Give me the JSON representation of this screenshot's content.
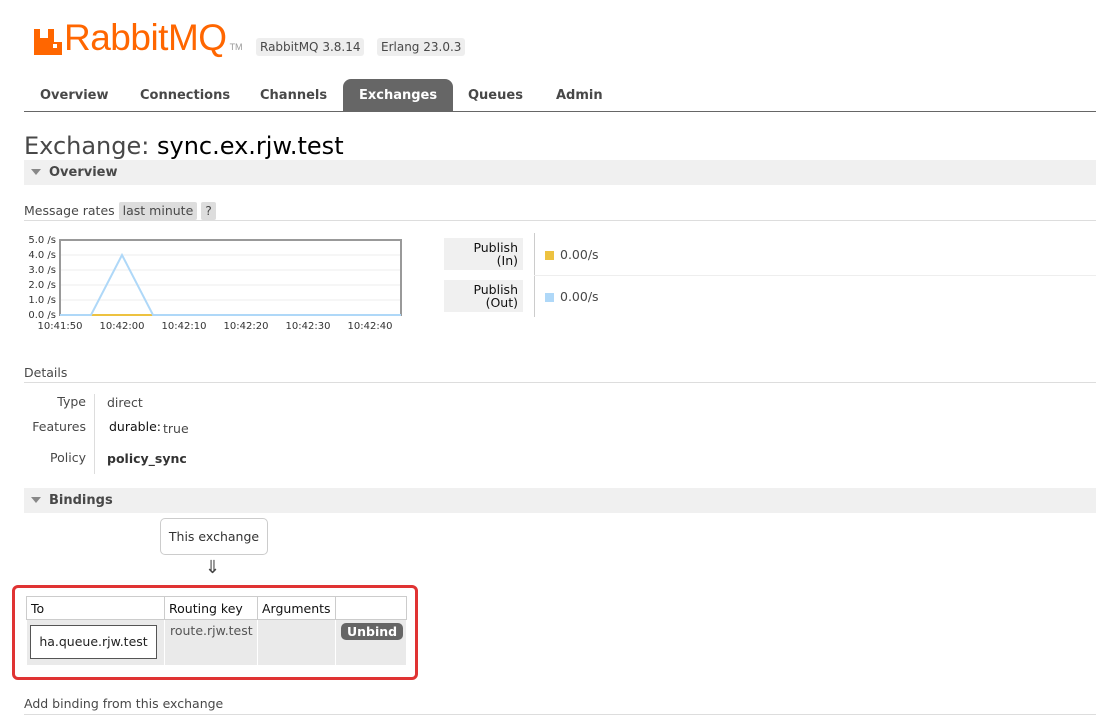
{
  "app": {
    "brand": "RabbitMQ",
    "trademark": "TM",
    "version": "RabbitMQ 3.8.14",
    "erlang": "Erlang 23.0.3",
    "brand_color": "#ff6600"
  },
  "tabs": [
    {
      "label": "Overview",
      "active": false
    },
    {
      "label": "Connections",
      "active": false
    },
    {
      "label": "Channels",
      "active": false
    },
    {
      "label": "Exchanges",
      "active": true
    },
    {
      "label": "Queues",
      "active": false
    },
    {
      "label": "Admin",
      "active": false
    }
  ],
  "page": {
    "title_prefix": "Exchange:",
    "exchange_name": "sync.ex.rjw.test"
  },
  "overview": {
    "section_label": "Overview",
    "rates_label": "Message rates",
    "period": "last minute",
    "help": "?",
    "publish_in": {
      "label_line1": "Publish",
      "label_line2": "(In)",
      "value": "0.00/s",
      "color": "#edc240"
    },
    "publish_out": {
      "label_line1": "Publish",
      "label_line2": "(Out)",
      "value": "0.00/s",
      "color": "#afd8f8"
    }
  },
  "chart_data": {
    "type": "line",
    "x": [
      "10:41:50",
      "10:41:55",
      "10:42:00",
      "10:42:05",
      "10:42:10",
      "10:42:20",
      "10:42:30",
      "10:42:40",
      "10:42:45"
    ],
    "x_ticks": [
      "10:41:50",
      "10:42:00",
      "10:42:10",
      "10:42:20",
      "10:42:30",
      "10:42:40"
    ],
    "y_ticks": [
      "0.0 /s",
      "1.0 /s",
      "2.0 /s",
      "3.0 /s",
      "4.0 /s",
      "5.0 /s"
    ],
    "ylim": [
      0,
      5
    ],
    "series": [
      {
        "color": "#afd8f8",
        "values": [
          0,
          0,
          4,
          0,
          0,
          0,
          0,
          0,
          0
        ]
      },
      {
        "color": "#edc240",
        "values": [
          0,
          0,
          0,
          0,
          0,
          0,
          0,
          0,
          0
        ]
      }
    ],
    "grid": true
  },
  "details": {
    "label": "Details",
    "type_key": "Type",
    "type_value": "direct",
    "features_key": "Features",
    "durable_key": "durable:",
    "durable_value": "true",
    "policy_key": "Policy",
    "policy_value": "policy_sync"
  },
  "bindings": {
    "section_label": "Bindings",
    "source_label": "This exchange",
    "arrow": "⇓",
    "columns": [
      "To",
      "Routing key",
      "Arguments",
      ""
    ],
    "rows": [
      {
        "to": "ha.queue.rjw.test",
        "routing_key": "route.rjw.test",
        "arguments": "",
        "action": "Unbind"
      }
    ]
  },
  "add_binding_label": "Add binding from this exchange"
}
